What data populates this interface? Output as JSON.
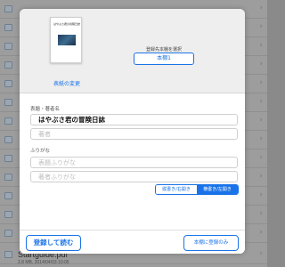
{
  "background": {
    "file_name": "Startguide.pdf",
    "file_meta": "2.8 MB, 2014/04/03 10:05"
  },
  "modal": {
    "cover": {
      "title_text": "はやぶさ君の冒険日誌",
      "change_link": "表紙の変更"
    },
    "shelf": {
      "label": "登録先本棚を選択",
      "button": "本棚1"
    },
    "title_section": {
      "label": "表題・著者名",
      "title_value": "はやぶさ君の冒険日誌",
      "author_placeholder": "著者"
    },
    "furigana_section": {
      "label": "ふりがな",
      "title_placeholder": "表題ふりがな",
      "author_placeholder": "著者ふりがな"
    },
    "binding": {
      "vertical_label": "縦書き/右開き",
      "horizontal_label": "横書き/左開き",
      "selected": "horizontal"
    },
    "footer": {
      "read_button": "登録して読む",
      "register_button": "本棚に登録のみ"
    }
  },
  "colors": {
    "accent": "#1a73e8",
    "overlay": "#9d9d9d"
  }
}
